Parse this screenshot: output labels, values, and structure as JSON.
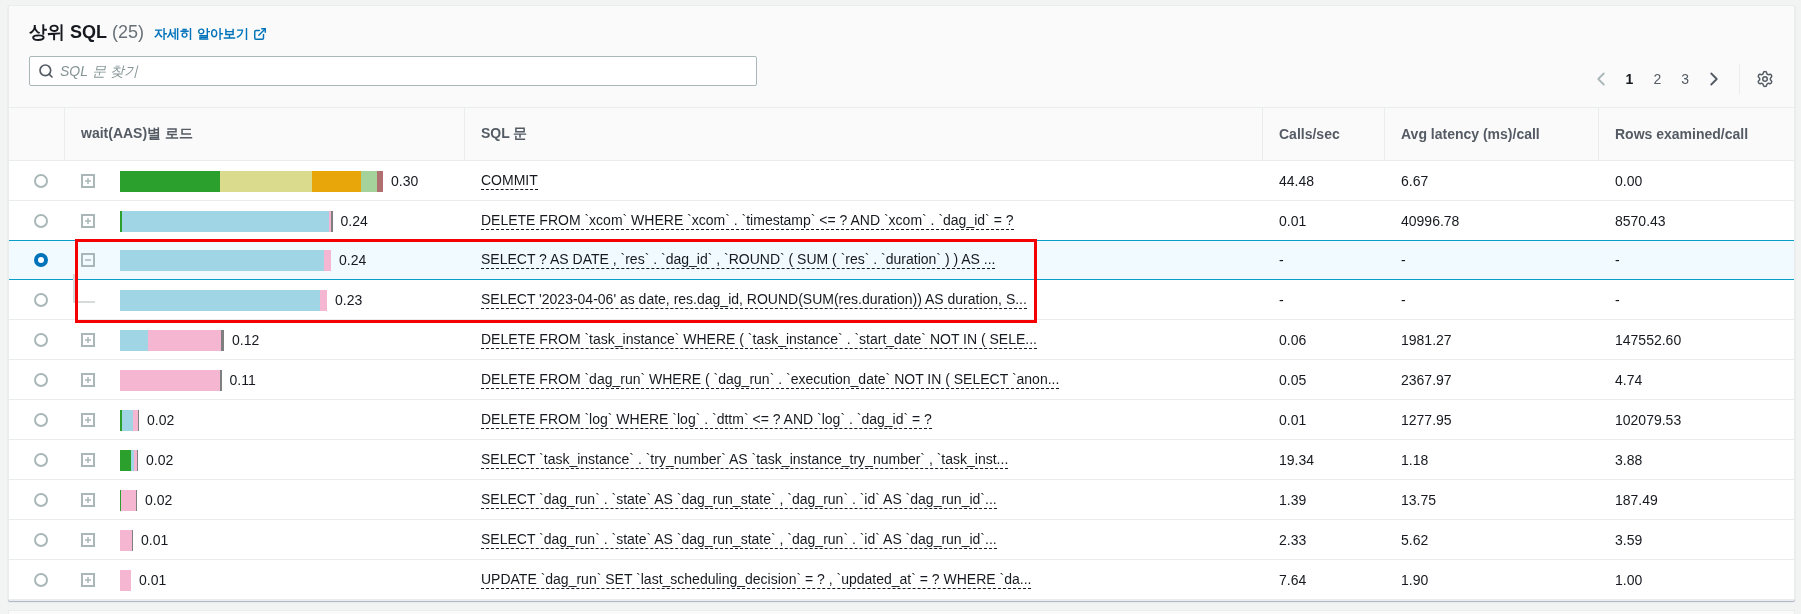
{
  "header": {
    "title": "상위 SQL",
    "count": "(25)",
    "info_link": "자세히 알아보기"
  },
  "search": {
    "placeholder": "SQL 문 찾기"
  },
  "pagination": {
    "prev_disabled": true,
    "pages": [
      {
        "label": "1",
        "selected": true
      },
      {
        "label": "2",
        "selected": false
      },
      {
        "label": "3",
        "selected": false
      }
    ],
    "next_disabled": false
  },
  "table": {
    "columns": [
      "wait(AAS)별 로드",
      "SQL 문",
      "Calls/sec",
      "Avg latency (ms)/call",
      "Rows examined/call"
    ],
    "rows": [
      {
        "selected": false,
        "expanded": false,
        "load": {
          "value": "0.30",
          "segments": [
            {
              "color": "#2ca02c"
            },
            {
              "color": "#dbdb8d"
            },
            {
              "color": "#e8a60b"
            },
            {
              "color": "#a5d19a"
            },
            {
              "color": "#b07070"
            }
          ]
        },
        "sql": "COMMIT",
        "calls": "44.48",
        "latency": "6.67",
        "rows_examined": "0.00"
      },
      {
        "selected": false,
        "expanded": false,
        "load": {
          "value": "0.24",
          "segments": [
            {
              "color": "#2ca02c"
            },
            {
              "color": "#9fd5e4"
            },
            {
              "color": "#f5b6d2"
            },
            {
              "color": "#7f7f7f"
            }
          ]
        },
        "sql": "DELETE FROM `xcom` WHERE `xcom` . `timestamp` <= ? AND `xcom` . `dag_id` = ?",
        "calls": "0.01",
        "latency": "40996.78",
        "rows_examined": "8570.43"
      },
      {
        "selected": true,
        "expanded": true,
        "highlighted": true,
        "load": {
          "value": "0.24",
          "segments": [
            {
              "color": "#9fd5e4"
            },
            {
              "color": "#f5b6d2"
            }
          ]
        },
        "sql": "SELECT ? AS DATE , `res` . `dag_id` , `ROUND` ( SUM ( `res` . `duration` ) ) AS ...",
        "calls": "-",
        "latency": "-",
        "rows_examined": "-",
        "children": [
          {
            "selected": false,
            "load": {
              "value": "0.23",
              "segments": [
                {
                  "color": "#9fd5e4"
                },
                {
                  "color": "#f5b6d2"
                }
              ]
            },
            "sql": "SELECT '2023-04-06' as date, res.dag_id, ROUND(SUM(res.duration)) AS duration, S...",
            "calls": "-",
            "latency": "-",
            "rows_examined": "-"
          }
        ]
      },
      {
        "selected": false,
        "expanded": false,
        "load": {
          "value": "0.12",
          "segments": [
            {
              "color": "#9fd5e4"
            },
            {
              "color": "#f5b6d2"
            },
            {
              "color": "#7f7f7f"
            }
          ]
        },
        "sql": "DELETE FROM `task_instance` WHERE ( `task_instance` . `start_date` NOT IN ( SELE...",
        "calls": "0.06",
        "latency": "1981.27",
        "rows_examined": "147552.60"
      },
      {
        "selected": false,
        "expanded": false,
        "load": {
          "value": "0.11",
          "segments": [
            {
              "color": "#f5b6d2"
            },
            {
              "color": "#7f7f7f"
            }
          ]
        },
        "sql": "DELETE FROM `dag_run` WHERE ( `dag_run` . `execution_date` NOT IN ( SELECT `anon...",
        "calls": "0.05",
        "latency": "2367.97",
        "rows_examined": "4.74"
      },
      {
        "selected": false,
        "expanded": false,
        "load": {
          "value": "0.02",
          "segments": [
            {
              "color": "#2ca02c"
            },
            {
              "color": "#9fd5e4"
            },
            {
              "color": "#f5b6d2"
            },
            {
              "color": "#7f7f7f"
            }
          ]
        },
        "sql": "DELETE FROM `log` WHERE `log` . `dttm` <= ? AND `log` . `dag_id` = ?",
        "calls": "0.01",
        "latency": "1277.95",
        "rows_examined": "102079.53"
      },
      {
        "selected": false,
        "expanded": false,
        "load": {
          "value": "0.02",
          "segments": [
            {
              "color": "#2ca02c"
            },
            {
              "color": "#9fd5e4"
            },
            {
              "color": "#f5b6d2"
            },
            {
              "color": "#7f7f7f"
            }
          ]
        },
        "sql": "SELECT `task_instance` . `try_number` AS `task_instance_try_number` , `task_inst...",
        "calls": "19.34",
        "latency": "1.18",
        "rows_examined": "3.88"
      },
      {
        "selected": false,
        "expanded": false,
        "load": {
          "value": "0.02",
          "segments": [
            {
              "color": "#2ca02c"
            },
            {
              "color": "#f5b6d2"
            },
            {
              "color": "#7f7f7f"
            }
          ]
        },
        "sql": "SELECT `dag_run` . `state` AS `dag_run_state` , `dag_run` . `id` AS `dag_run_id`...",
        "calls": "1.39",
        "latency": "13.75",
        "rows_examined": "187.49"
      },
      {
        "selected": false,
        "expanded": false,
        "load": {
          "value": "0.01",
          "segments": [
            {
              "color": "#f5b6d2"
            },
            {
              "color": "#7f7f7f"
            }
          ]
        },
        "sql": "SELECT `dag_run` . `state` AS `dag_run_state` , `dag_run` . `id` AS `dag_run_id`...",
        "calls": "2.33",
        "latency": "5.62",
        "rows_examined": "3.59"
      },
      {
        "selected": false,
        "expanded": false,
        "load": {
          "value": "0.01",
          "segments": [
            {
              "color": "#f5b6d2"
            }
          ]
        },
        "sql": "UPDATE `dag_run` SET `last_scheduling_decision` = ? , `updated_at` = ? WHERE `da...",
        "calls": "7.64",
        "latency": "1.90",
        "rows_examined": "1.00"
      }
    ]
  }
}
